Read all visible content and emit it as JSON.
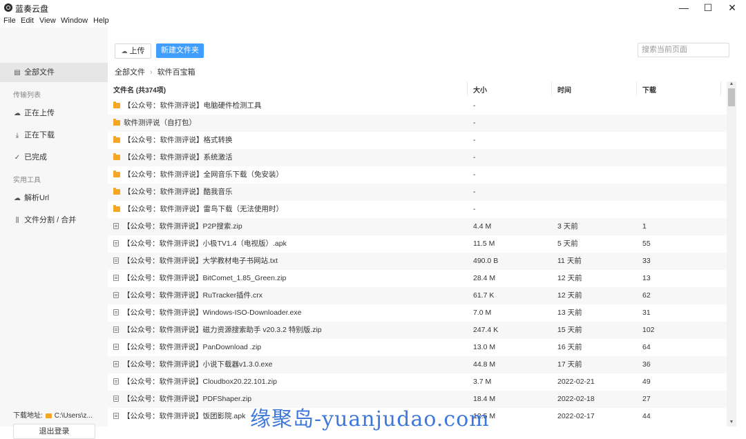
{
  "window": {
    "title": "蓝奏云盘",
    "minimize": "—",
    "maximize": "☐",
    "close": "✕"
  },
  "menu": [
    "File",
    "Edit",
    "View",
    "Window",
    "Help"
  ],
  "sidebar": {
    "all_files": "全部文件",
    "transfer_section": "传输列表",
    "uploading": "正在上传",
    "downloading": "正在下载",
    "completed": "已完成",
    "tools_section": "实用工具",
    "parse_url": "解析Url",
    "split_merge": "文件分割 / 合并",
    "download_path_label": "下载地址:",
    "download_path_value": "C:\\Users\\z...",
    "logout": "退出登录"
  },
  "toolbar": {
    "upload": "上传",
    "new_folder": "新建文件夹",
    "search_placeholder": "搜索当前页面"
  },
  "breadcrumb": [
    "全部文件",
    "软件百宝箱"
  ],
  "table": {
    "headers": [
      "文件名 (共374项)",
      "大小",
      "时间",
      "下载"
    ],
    "rows": [
      {
        "type": "folder",
        "name": "【公众号：软件测评说】电脑硬件检测工具",
        "size": "-",
        "time": "",
        "downloads": ""
      },
      {
        "type": "folder",
        "name": "软件测评说（自打包）",
        "size": "-",
        "time": "",
        "downloads": ""
      },
      {
        "type": "folder",
        "name": "【公众号：软件测评说】格式转换",
        "size": "-",
        "time": "",
        "downloads": ""
      },
      {
        "type": "folder",
        "name": "【公众号：软件测评说】系统激活",
        "size": "-",
        "time": "",
        "downloads": ""
      },
      {
        "type": "folder",
        "name": "【公众号：软件测评说】全网音乐下载（免安装）",
        "size": "-",
        "time": "",
        "downloads": ""
      },
      {
        "type": "folder",
        "name": "【公众号：软件测评说】酷我音乐",
        "size": "-",
        "time": "",
        "downloads": ""
      },
      {
        "type": "folder",
        "name": "【公众号：软件测评说】雷鸟下载（无法使用时）",
        "size": "-",
        "time": "",
        "downloads": ""
      },
      {
        "type": "file",
        "name": "【公众号：软件测评说】P2P搜索.zip",
        "size": "4.4 M",
        "time": "3 天前",
        "downloads": "1"
      },
      {
        "type": "file",
        "name": "【公众号：软件测评说】小极TV1.4（电视版）.apk",
        "size": "11.5 M",
        "time": "5 天前",
        "downloads": "55"
      },
      {
        "type": "file",
        "name": "【公众号：软件测评说】大学教材电子书网站.txt",
        "size": "490.0 B",
        "time": "11 天前",
        "downloads": "33"
      },
      {
        "type": "file",
        "name": "【公众号：软件测评说】BitComet_1.85_Green.zip",
        "size": "28.4 M",
        "time": "12 天前",
        "downloads": "13"
      },
      {
        "type": "file",
        "name": "【公众号：软件测评说】RuTracker插件.crx",
        "size": "61.7 K",
        "time": "12 天前",
        "downloads": "62"
      },
      {
        "type": "file",
        "name": "【公众号：软件测评说】Windows-ISO-Downloader.exe",
        "size": "7.0 M",
        "time": "13 天前",
        "downloads": "31"
      },
      {
        "type": "file",
        "name": "【公众号：软件测评说】磁力资源搜索助手 v20.3.2 特别版.zip",
        "size": "247.4 K",
        "time": "15 天前",
        "downloads": "102"
      },
      {
        "type": "file",
        "name": "【公众号：软件测评说】PanDownload .zip",
        "size": "13.0 M",
        "time": "16 天前",
        "downloads": "64"
      },
      {
        "type": "file",
        "name": "【公众号：软件测评说】小说下载器v1.3.0.exe",
        "size": "44.8 M",
        "time": "17 天前",
        "downloads": "36"
      },
      {
        "type": "file",
        "name": "【公众号：软件测评说】Cloudbox20.22.101.zip",
        "size": "3.7 M",
        "time": "2022-02-21",
        "downloads": "49"
      },
      {
        "type": "file",
        "name": "【公众号：软件测评说】PDFShaper.zip",
        "size": "18.4 M",
        "time": "2022-02-18",
        "downloads": "27"
      },
      {
        "type": "file",
        "name": "【公众号：软件测评说】饭团影院.apk",
        "size": "12.5 M",
        "time": "2022-02-17",
        "downloads": "44"
      }
    ]
  },
  "watermark": "缘聚岛-yuanjudao.com"
}
